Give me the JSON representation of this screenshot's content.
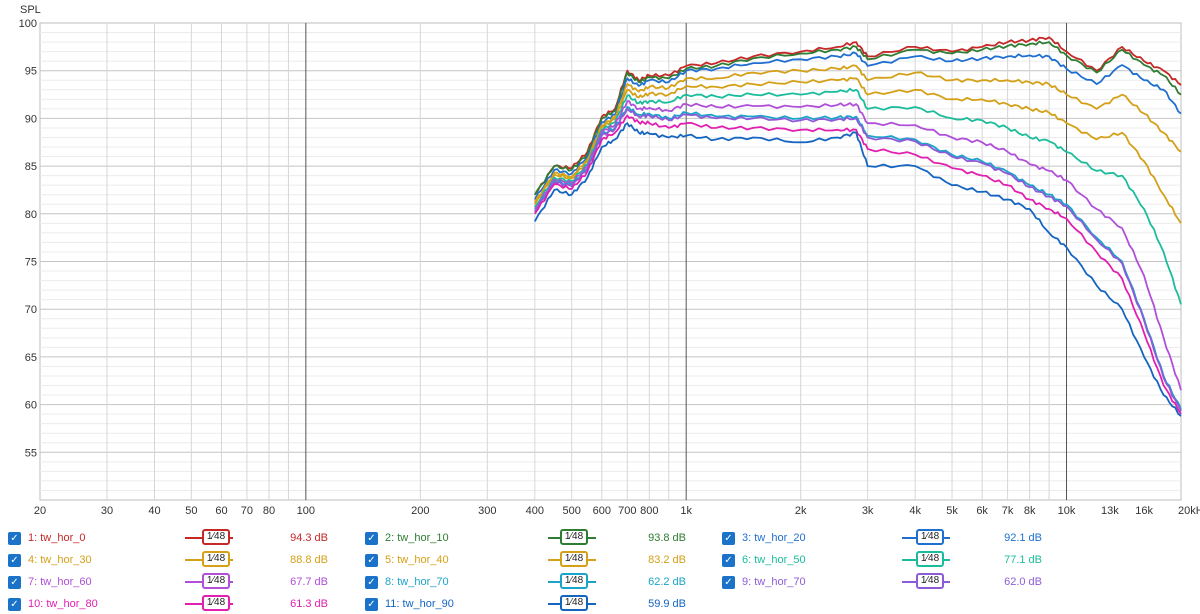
{
  "chart_data": {
    "type": "line",
    "ylabel": "SPL",
    "xlabel": "",
    "x_scale": "log",
    "xlim": [
      20,
      20000
    ],
    "ylim": [
      50,
      100
    ],
    "y_ticks": [
      "55",
      "60",
      "65",
      "70",
      "75",
      "80",
      "85",
      "90",
      "95",
      "100"
    ],
    "x_ticks": [
      {
        "v": 20,
        "t": "20"
      },
      {
        "v": 30,
        "t": "30"
      },
      {
        "v": 40,
        "t": "40"
      },
      {
        "v": 50,
        "t": "50"
      },
      {
        "v": 60,
        "t": "60"
      },
      {
        "v": 70,
        "t": "70"
      },
      {
        "v": 80,
        "t": "80"
      },
      {
        "v": 100,
        "t": "100"
      },
      {
        "v": 200,
        "t": "200"
      },
      {
        "v": 300,
        "t": "300"
      },
      {
        "v": 400,
        "t": "400"
      },
      {
        "v": 500,
        "t": "500"
      },
      {
        "v": 600,
        "t": "600"
      },
      {
        "v": 700,
        "t": "700"
      },
      {
        "v": 800,
        "t": "800"
      },
      {
        "v": 1000,
        "t": "1k"
      },
      {
        "v": 2000,
        "t": "2k"
      },
      {
        "v": 3000,
        "t": "3k"
      },
      {
        "v": 4000,
        "t": "4k"
      },
      {
        "v": 5000,
        "t": "5k"
      },
      {
        "v": 6000,
        "t": "6k"
      },
      {
        "v": 7000,
        "t": "7k"
      },
      {
        "v": 8000,
        "t": "8k"
      },
      {
        "v": 10000,
        "t": "10k"
      },
      {
        "v": 13000,
        "t": "13k"
      },
      {
        "v": 16000,
        "t": "16k"
      },
      {
        "v": 20000,
        "t": "20kHz"
      }
    ],
    "grid": true,
    "x": [
      400,
      450,
      500,
      550,
      600,
      650,
      700,
      750,
      800,
      900,
      1000,
      1200,
      1500,
      2000,
      2500,
      2800,
      3000,
      4000,
      5000,
      6000,
      7000,
      8000,
      9000,
      10000,
      12000,
      14000,
      16000,
      18000,
      20000
    ],
    "series": [
      {
        "name": "1: tw_hor_0",
        "color": "#c62828",
        "smoothing_label": "1⁄48",
        "level": "94.3 dB",
        "values": [
          82,
          85,
          84.8,
          86.5,
          90.2,
          91,
          95,
          94,
          94.5,
          94.5,
          95.5,
          95.8,
          96.5,
          97,
          97.5,
          98,
          96.5,
          97.5,
          97,
          97.5,
          98,
          98.2,
          98.5,
          97,
          95,
          97.5,
          96,
          95,
          93.5
        ]
      },
      {
        "name": "2: tw_hor_10",
        "color": "#2e7d32",
        "smoothing_label": "1⁄48",
        "level": "93.8 dB",
        "values": [
          82,
          85,
          84.6,
          86.3,
          90,
          90.8,
          94.8,
          93.8,
          94.3,
          94.2,
          95.2,
          95.5,
          96.3,
          96.8,
          97.2,
          97.5,
          96.2,
          97.2,
          96.8,
          97.2,
          97.6,
          97.8,
          98,
          96.6,
          94.8,
          97.2,
          95.6,
          94.5,
          92.5
        ]
      },
      {
        "name": "3: tw_hor_20",
        "color": "#1e6fd0",
        "smoothing_label": "1⁄48",
        "level": "92.1 dB",
        "values": [
          81.5,
          84.6,
          84.2,
          86,
          89.6,
          90.4,
          94.2,
          93.4,
          94,
          93.8,
          95,
          95.2,
          95.8,
          96.2,
          96.5,
          96.8,
          95.5,
          96.5,
          96,
          96.3,
          96.5,
          96.6,
          96.5,
          95.2,
          93.6,
          95.6,
          94,
          93,
          90.5
        ]
      },
      {
        "name": "4: tw_hor_30",
        "color": "#d4a017",
        "smoothing_label": "1⁄48",
        "level": "88.8 dB",
        "values": [
          81.2,
          84.3,
          83.9,
          85.7,
          89.3,
          90.1,
          93.6,
          92.8,
          93.3,
          93.2,
          94.2,
          94.2,
          94.8,
          95,
          95.2,
          95.5,
          94,
          94.8,
          94,
          94,
          94,
          93.8,
          93.6,
          92.5,
          91,
          92.5,
          90.5,
          88.5,
          86.5
        ]
      },
      {
        "name": "5: tw_hor_40",
        "color": "#d4a017",
        "smoothing_label": "1⁄48",
        "level": "83.2 dB",
        "values": [
          81,
          84.1,
          83.7,
          85.5,
          89.1,
          89.9,
          93,
          92.2,
          92.6,
          92.5,
          93.4,
          93.3,
          93.6,
          93.8,
          94,
          94.2,
          92.5,
          93,
          92,
          92,
          91.5,
          91,
          90.6,
          89.5,
          87.8,
          88.5,
          85.5,
          82,
          79
        ]
      },
      {
        "name": "6: tw_hor_50",
        "color": "#1abc9c",
        "smoothing_label": "1⁄48",
        "level": "77.1 dB",
        "values": [
          80.7,
          83.8,
          83.4,
          85.2,
          88.8,
          89.6,
          92.4,
          91.6,
          91.8,
          91.7,
          92.5,
          92.3,
          92.5,
          92.5,
          92.8,
          93,
          91,
          91.2,
          90,
          89.8,
          89,
          88,
          87.6,
          86.5,
          84.5,
          84,
          80.5,
          76,
          70.5
        ]
      },
      {
        "name": "7: tw_hor_60",
        "color": "#b04fd8",
        "smoothing_label": "1⁄48",
        "level": "67.7 dB",
        "values": [
          80.5,
          83.6,
          83.2,
          85,
          88.6,
          89.3,
          91.8,
          91,
          91.1,
          90.8,
          91.5,
          91.2,
          91.3,
          91.2,
          91.4,
          91.5,
          89.5,
          89.3,
          88,
          87.5,
          86.5,
          85.2,
          84.5,
          83.5,
          80.5,
          78.5,
          73.5,
          67,
          61.5
        ]
      },
      {
        "name": "8: tw_hor_70",
        "color": "#1ba3c9",
        "smoothing_label": "1⁄48",
        "level": "62.2 dB",
        "values": [
          80.3,
          83.4,
          83,
          84.8,
          88.3,
          89,
          91.2,
          90.4,
          90.5,
          90,
          90.6,
          90.2,
          90.2,
          90,
          90.1,
          90.2,
          88.2,
          87.8,
          86.2,
          85.5,
          84.4,
          83,
          82,
          81,
          77.5,
          75,
          69,
          63,
          59.5
        ]
      },
      {
        "name": "9: tw_hor_70",
        "color": "#8e5bd8",
        "smoothing_label": "1⁄48",
        "level": "62.0 dB",
        "values": [
          80.2,
          83.3,
          82.9,
          84.7,
          88.2,
          88.9,
          91,
          90.2,
          90.3,
          89.8,
          90.4,
          90,
          90,
          89.8,
          89.9,
          90,
          88,
          87.6,
          86,
          85.3,
          84.2,
          82.8,
          81.8,
          80.8,
          77.3,
          74.8,
          68.8,
          62.8,
          59.3
        ]
      },
      {
        "name": "10: tw_hor_80",
        "color": "#e020b0",
        "smoothing_label": "1⁄48",
        "level": "61.3 dB",
        "values": [
          80,
          83.1,
          82.6,
          84.4,
          87.8,
          88.5,
          90.3,
          89.6,
          89.5,
          89,
          89.5,
          89,
          89,
          88.8,
          88.8,
          88.8,
          86.8,
          86.2,
          84.8,
          84,
          83,
          81.5,
          80.5,
          79.5,
          76,
          73.2,
          67.5,
          62,
          59
        ]
      },
      {
        "name": "11: tw_hor_90",
        "color": "#1565c0",
        "smoothing_label": "1⁄48",
        "level": "59.9 dB",
        "values": [
          79.2,
          82.5,
          82,
          83.8,
          87,
          87.8,
          89.5,
          88.5,
          88.4,
          88,
          88.2,
          87.8,
          88,
          87.5,
          88,
          88.5,
          85,
          85,
          83,
          82.3,
          81.5,
          80.5,
          78,
          76.5,
          72.5,
          70,
          65,
          61,
          58.8
        ]
      }
    ]
  }
}
